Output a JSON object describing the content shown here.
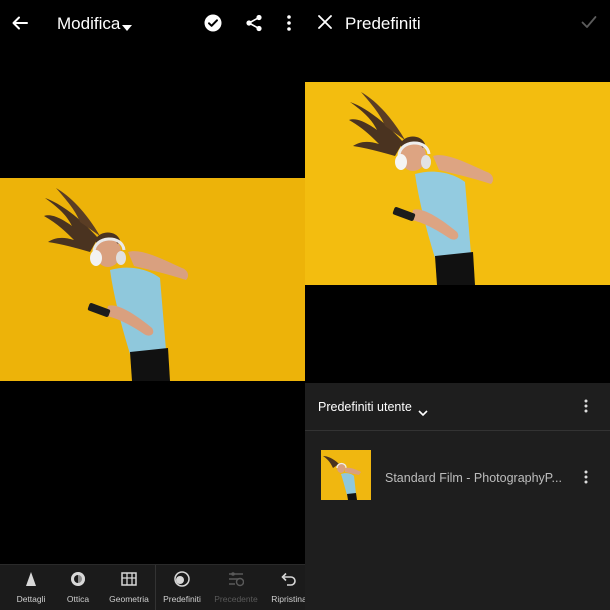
{
  "left": {
    "header": {
      "title": "Modifica"
    },
    "toolbar": [
      {
        "label": "Dettagli",
        "icon": "detail-triangle-icon",
        "enabled": true
      },
      {
        "label": "Ottica",
        "icon": "lens-icon",
        "enabled": true
      },
      {
        "label": "Geometria",
        "icon": "geometry-grid-icon",
        "enabled": true
      },
      {
        "label": "Predefiniti",
        "icon": "presets-icon",
        "enabled": true
      },
      {
        "label": "Precedente",
        "icon": "previous-sliders-icon",
        "enabled": false
      },
      {
        "label": "Ripristina",
        "icon": "undo-icon",
        "enabled": true
      }
    ]
  },
  "right": {
    "header": {
      "title": "Predefiniti"
    },
    "panel": {
      "group_label": "Predefiniti utente",
      "preset": {
        "name": "Standard Film - PhotographyP..."
      }
    }
  },
  "colors": {
    "photo_background": "#f2b90c",
    "panel": "#1e1e1e",
    "toolbar": "#1b1b1b"
  }
}
